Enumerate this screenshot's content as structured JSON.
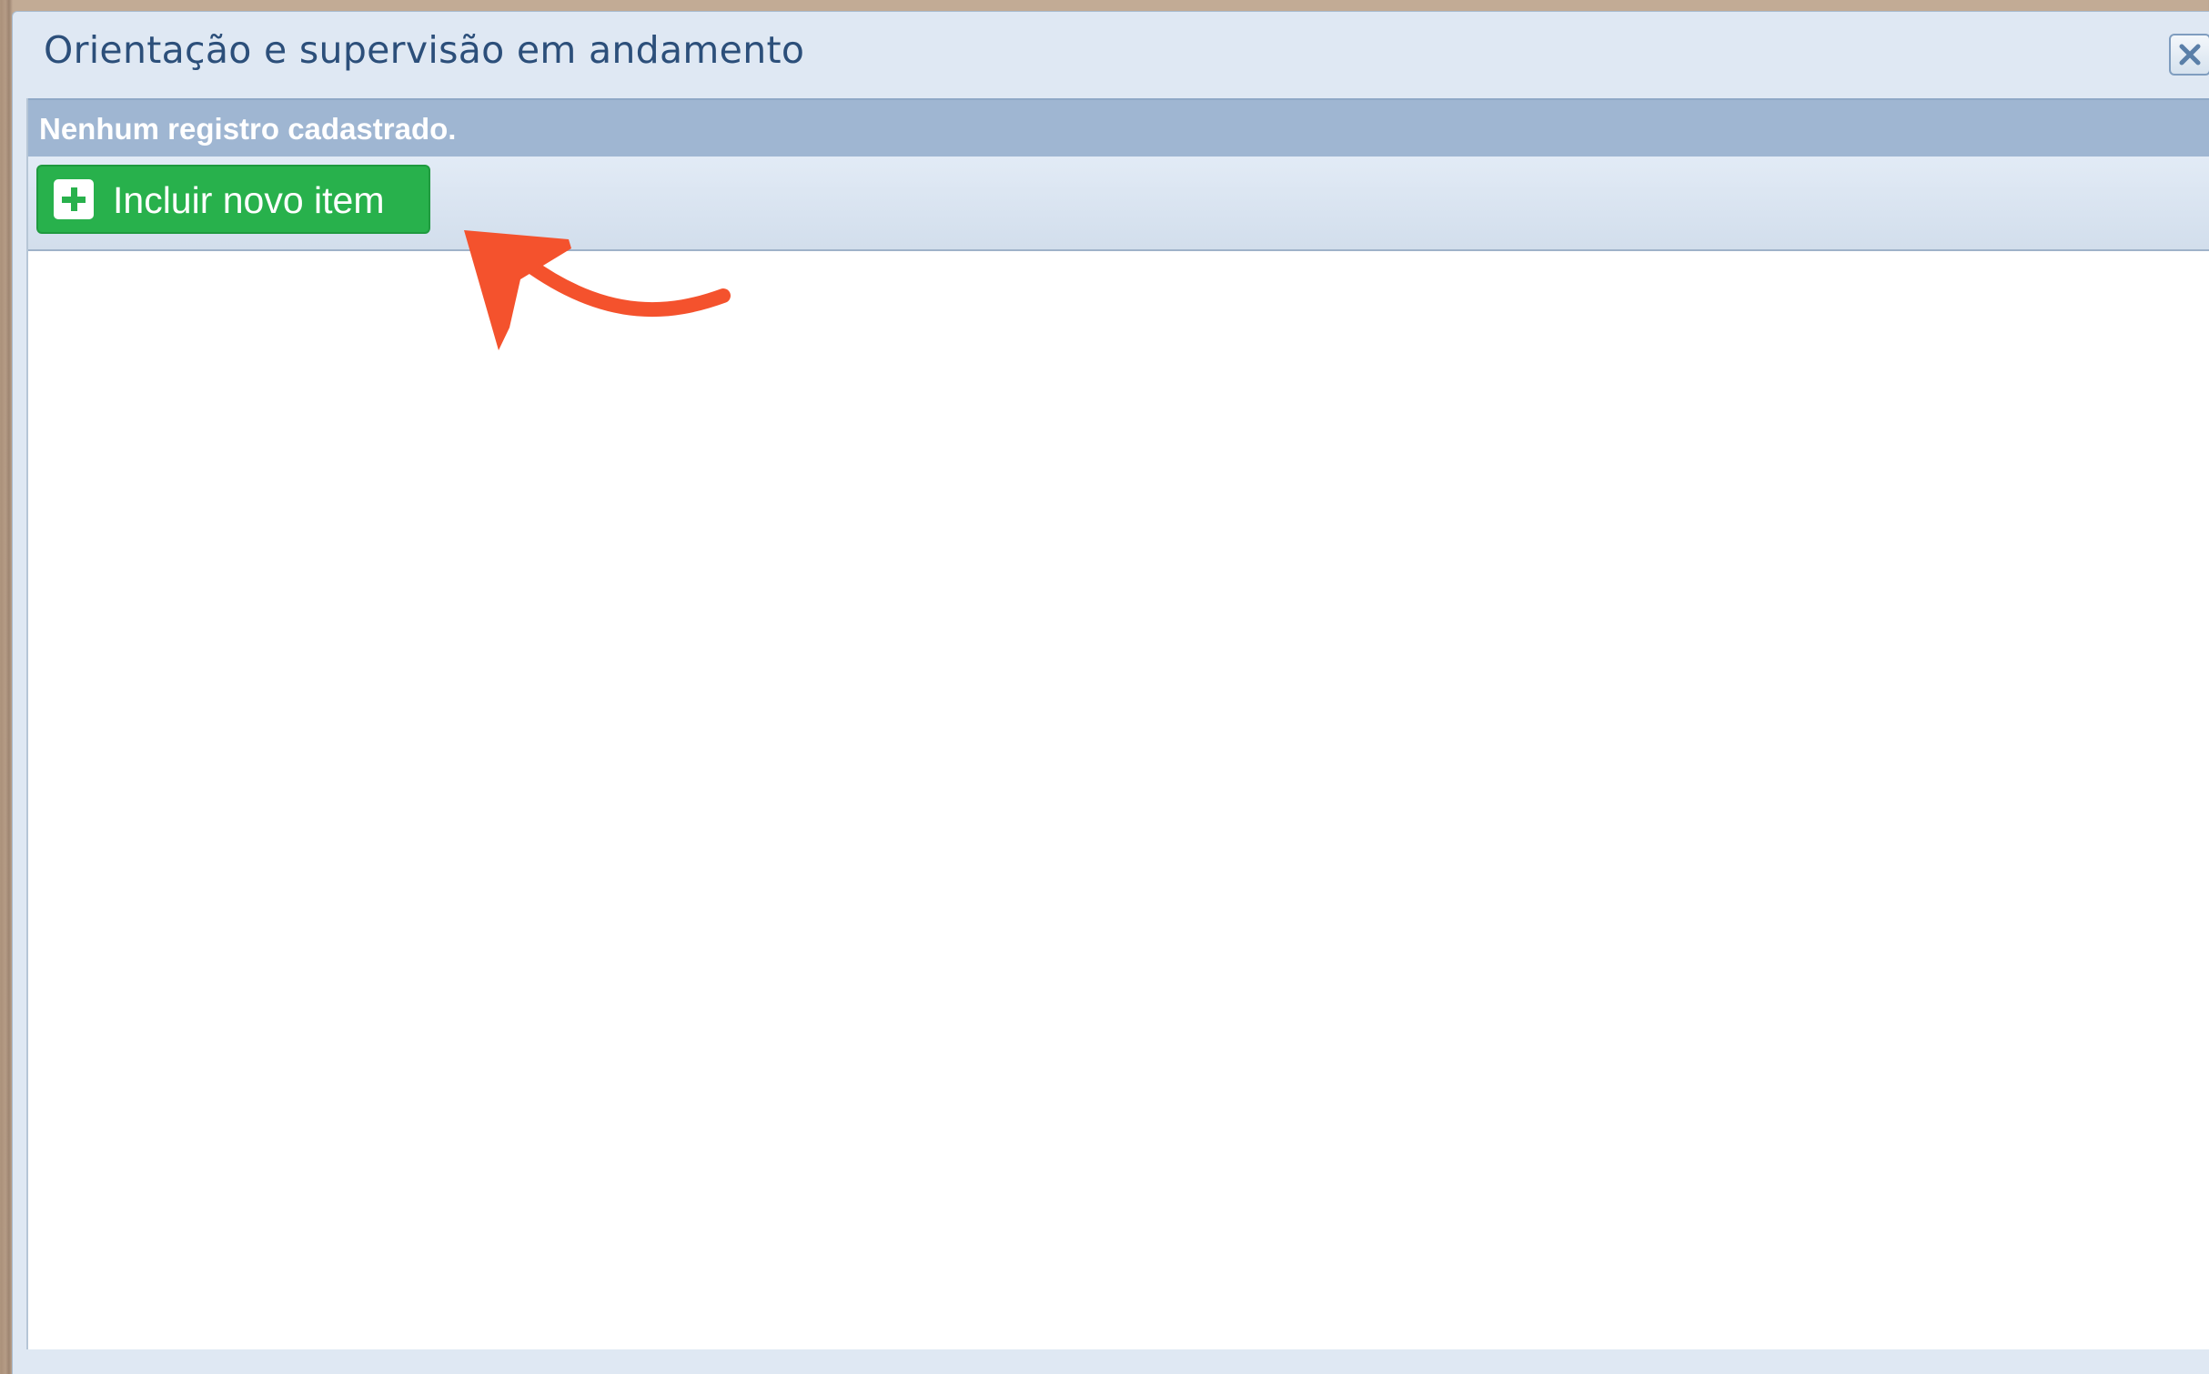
{
  "dialog": {
    "title": "Orientação e supervisão em andamento",
    "close_icon": "close-icon"
  },
  "panel": {
    "empty_message": "Nenhum registro cadastrado.",
    "add_button": {
      "label": "Incluir novo item",
      "icon": "plus-icon"
    }
  },
  "annotation": {
    "icon": "arrow-annotation",
    "color": "#f4522d"
  },
  "colors": {
    "accent_green": "#28b14c",
    "header_bar": "#9fb6d2",
    "title_text": "#2c4f7a"
  }
}
